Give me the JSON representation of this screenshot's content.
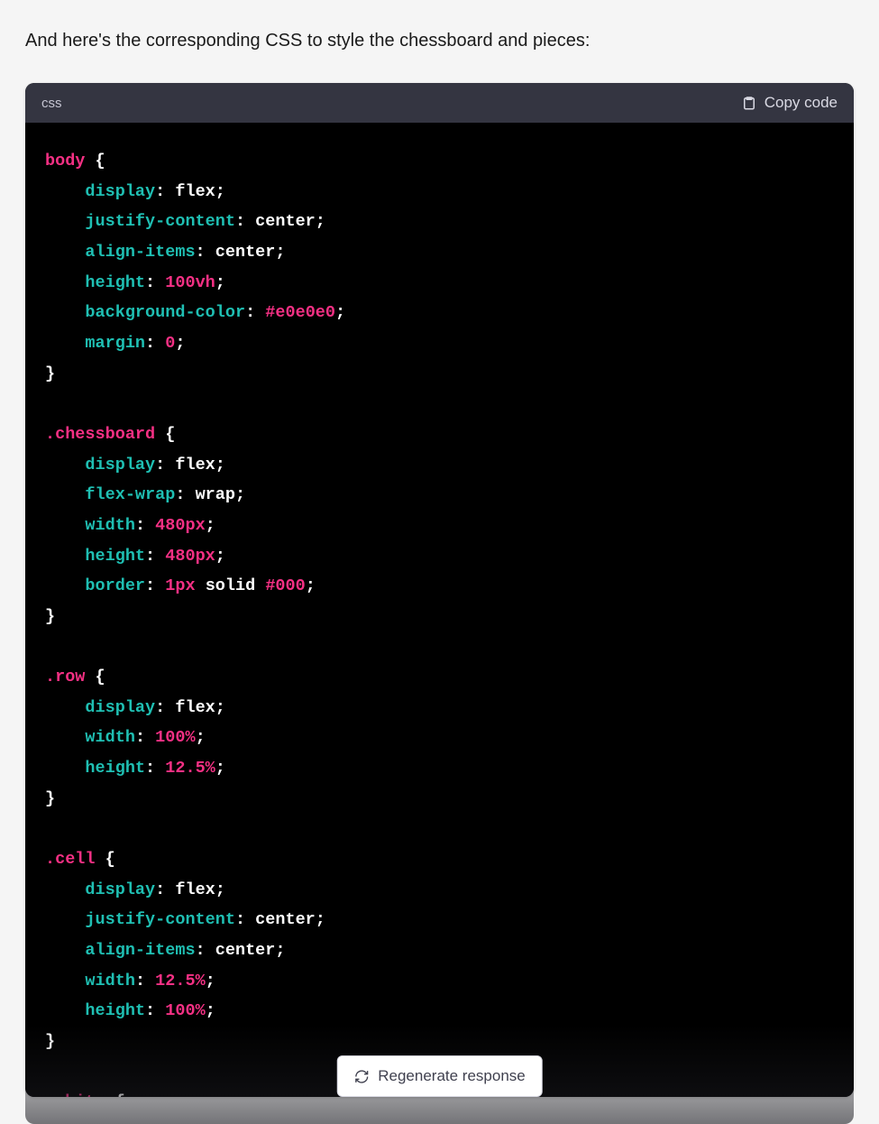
{
  "intro_text": "And here's the corresponding CSS to style the chessboard and pieces:",
  "code_block": {
    "language": "css",
    "copy_label": "Copy code",
    "rules": [
      {
        "selector": "body",
        "declarations": [
          {
            "prop": "display",
            "val": "flex",
            "valType": "keyword"
          },
          {
            "prop": "justify-content",
            "val": "center",
            "valType": "keyword"
          },
          {
            "prop": "align-items",
            "val": "center",
            "valType": "keyword"
          },
          {
            "prop": "height",
            "val": "100vh",
            "valType": "number"
          },
          {
            "prop": "background-color",
            "val": "#e0e0e0",
            "valType": "hex"
          },
          {
            "prop": "margin",
            "val": "0",
            "valType": "number"
          }
        ]
      },
      {
        "selector": ".chessboard",
        "declarations": [
          {
            "prop": "display",
            "val": "flex",
            "valType": "keyword"
          },
          {
            "prop": "flex-wrap",
            "val": "wrap",
            "valType": "keyword"
          },
          {
            "prop": "width",
            "val": "480px",
            "valType": "number"
          },
          {
            "prop": "height",
            "val": "480px",
            "valType": "number"
          },
          {
            "prop": "border",
            "val_parts": [
              {
                "t": "1px",
                "vt": "number"
              },
              {
                "t": "solid",
                "vt": "keyword"
              },
              {
                "t": "#000",
                "vt": "hex"
              }
            ]
          }
        ]
      },
      {
        "selector": ".row",
        "declarations": [
          {
            "prop": "display",
            "val": "flex",
            "valType": "keyword"
          },
          {
            "prop": "width",
            "val": "100%",
            "valType": "number"
          },
          {
            "prop": "height",
            "val": "12.5%",
            "valType": "number"
          }
        ]
      },
      {
        "selector": ".cell",
        "declarations": [
          {
            "prop": "display",
            "val": "flex",
            "valType": "keyword"
          },
          {
            "prop": "justify-content",
            "val": "center",
            "valType": "keyword"
          },
          {
            "prop": "align-items",
            "val": "center",
            "valType": "keyword"
          },
          {
            "prop": "width",
            "val": "12.5%",
            "valType": "number"
          },
          {
            "prop": "height",
            "val": "100%",
            "valType": "number"
          }
        ]
      },
      {
        "selector": ".white",
        "open_only": true,
        "declarations": []
      }
    ]
  },
  "regenerate_label": "Regenerate response",
  "colors": {
    "page_bg": "#f5f5f5",
    "header_bg": "#343541",
    "code_bg": "#000000",
    "selector": "#f53084",
    "property": "#1fbfb3",
    "value": "#ffffff",
    "number": "#f53084"
  }
}
